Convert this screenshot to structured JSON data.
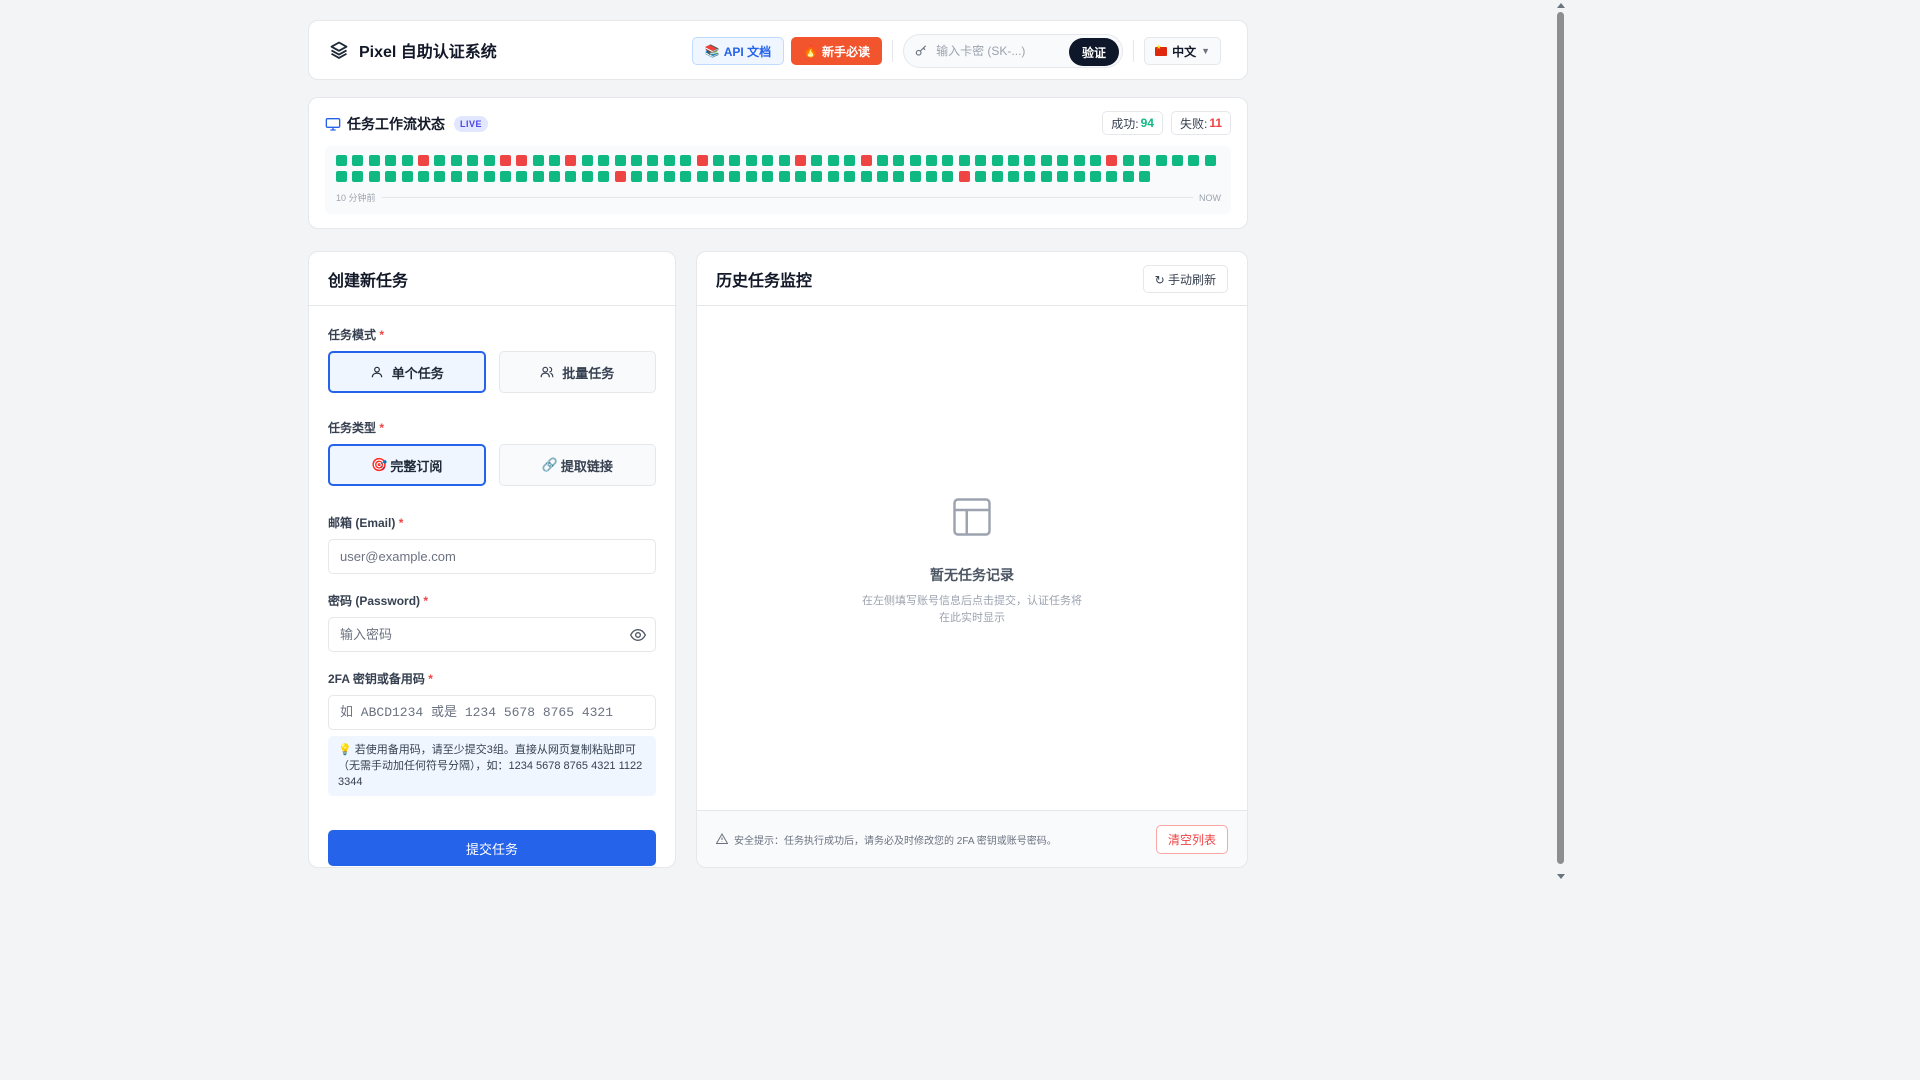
{
  "header": {
    "brand_title": "Pixel 自助认证系统",
    "api_docs_label": "API 文档",
    "newbie_label": "新手必读",
    "key_input_placeholder": "输入卡密 (SK-...)",
    "verify_label": "验证",
    "language_label": "中文"
  },
  "status": {
    "title": "任务工作流状态",
    "live_badge": "LIVE",
    "success_label": "成功:",
    "success_count": "94",
    "fail_label": "失败:",
    "fail_count": "11",
    "timeline_start": "10 分钟前",
    "timeline_end": "NOW",
    "cells": "sssssfssssffssfsssssssfsssssfsssfssssssssssssssfsssssssssssssssssssssssfssssssssssssssssssssfsssssssssss",
    "colors": {
      "success": "#10b981",
      "fail": "#ef4444"
    }
  },
  "create": {
    "title": "创建新任务",
    "mode_label": "任务模式",
    "mode_single": "单个任务",
    "mode_batch": "批量任务",
    "type_label": "任务类型",
    "type_full": "完整订阅",
    "type_link": "提取链接",
    "email_label": "邮箱 (Email)",
    "email_placeholder": "user@example.com",
    "password_label": "密码 (Password)",
    "password_placeholder": "输入密码",
    "twofa_label": "2FA 密钥或备用码",
    "twofa_placeholder": "如 ABCD1234 或是 1234 5678 8765 4321",
    "tip_text": "💡 若使用备用码，请至少提交3组。直接从网页复制粘贴即可（无需手动加任何符号分隔），如：1234 5678 8765 4321 1122 3344",
    "submit_label": "提交任务",
    "required_mark": "*"
  },
  "history": {
    "title": "历史任务监控",
    "refresh_label": "↻ 手动刷新",
    "empty_title": "暂无任务记录",
    "empty_desc": "在左侧填写账号信息后点击提交，认证任务将在此实时显示",
    "footer_tip": "安全提示：任务执行成功后，请务必及时修改您的 2FA 密钥或账号密码。",
    "clear_label": "清空列表"
  },
  "theme": {
    "accent": "#2563eb",
    "dark": "#0f172a",
    "danger": "#ef4444",
    "newbie": "#f2542d"
  }
}
